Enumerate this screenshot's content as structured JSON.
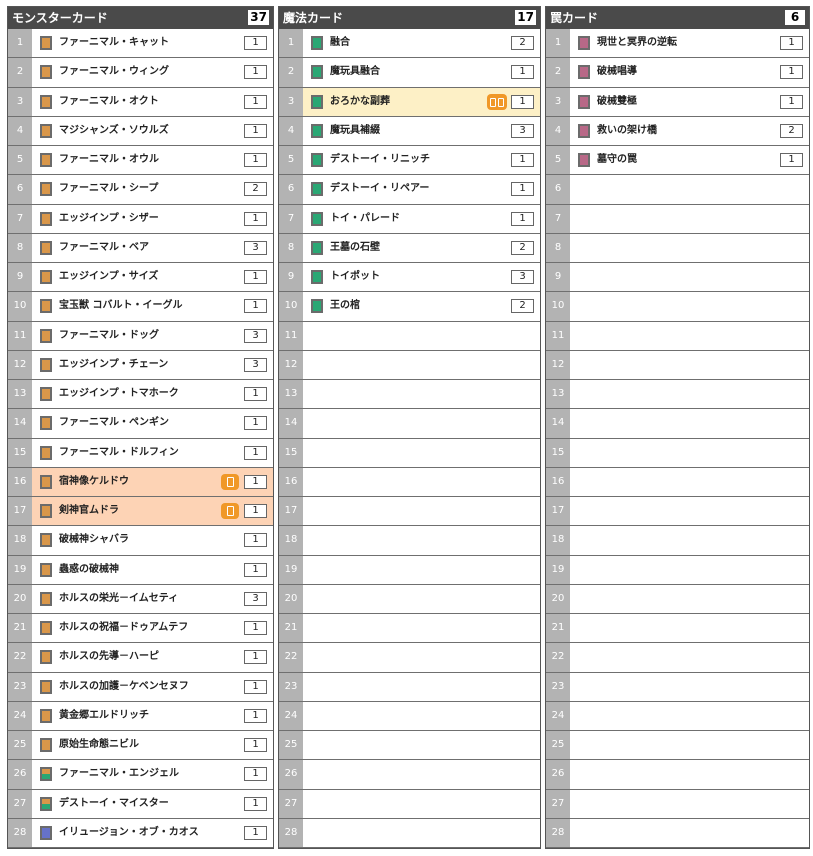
{
  "monster": {
    "title": "モンスターカード",
    "count": "37",
    "rows": [
      {
        "num": "1",
        "name": "ファーニマル・キャット",
        "qty": "1",
        "icon": "monster"
      },
      {
        "num": "2",
        "name": "ファーニマル・ウィング",
        "qty": "1",
        "icon": "monster"
      },
      {
        "num": "3",
        "name": "ファーニマル・オクト",
        "qty": "1",
        "icon": "monster"
      },
      {
        "num": "4",
        "name": "マジシャンズ・ソウルズ",
        "qty": "1",
        "icon": "monster"
      },
      {
        "num": "5",
        "name": "ファーニマル・オウル",
        "qty": "1",
        "icon": "monster"
      },
      {
        "num": "6",
        "name": "ファーニマル・シープ",
        "qty": "2",
        "icon": "monster"
      },
      {
        "num": "7",
        "name": "エッジインプ・シザー",
        "qty": "1",
        "icon": "monster"
      },
      {
        "num": "8",
        "name": "ファーニマル・ベア",
        "qty": "3",
        "icon": "monster"
      },
      {
        "num": "9",
        "name": "エッジインプ・サイズ",
        "qty": "1",
        "icon": "monster"
      },
      {
        "num": "10",
        "name": "宝玉獣 コバルト・イーグル",
        "qty": "1",
        "icon": "monster"
      },
      {
        "num": "11",
        "name": "ファーニマル・ドッグ",
        "qty": "3",
        "icon": "monster"
      },
      {
        "num": "12",
        "name": "エッジインプ・チェーン",
        "qty": "3",
        "icon": "monster"
      },
      {
        "num": "13",
        "name": "エッジインプ・トマホーク",
        "qty": "1",
        "icon": "monster"
      },
      {
        "num": "14",
        "name": "ファーニマル・ペンギン",
        "qty": "1",
        "icon": "monster"
      },
      {
        "num": "15",
        "name": "ファーニマル・ドルフィン",
        "qty": "1",
        "icon": "monster"
      },
      {
        "num": "16",
        "name": "宿神像ケルドウ",
        "qty": "1",
        "icon": "monster",
        "hl": "orange",
        "badge": "single"
      },
      {
        "num": "17",
        "name": "剣神官ムドラ",
        "qty": "1",
        "icon": "monster",
        "hl": "orange",
        "badge": "single"
      },
      {
        "num": "18",
        "name": "破械神シャバラ",
        "qty": "1",
        "icon": "monster"
      },
      {
        "num": "19",
        "name": "蟲惑の破械神",
        "qty": "1",
        "icon": "monster"
      },
      {
        "num": "20",
        "name": "ホルスの栄光－イムセティ",
        "qty": "3",
        "icon": "monster"
      },
      {
        "num": "21",
        "name": "ホルスの祝福－ドゥアムテフ",
        "qty": "1",
        "icon": "monster"
      },
      {
        "num": "22",
        "name": "ホルスの先導－ハーピ",
        "qty": "1",
        "icon": "monster"
      },
      {
        "num": "23",
        "name": "ホルスの加護－ケベンセヌフ",
        "qty": "1",
        "icon": "monster"
      },
      {
        "num": "24",
        "name": "黄金郷エルドリッチ",
        "qty": "1",
        "icon": "monster"
      },
      {
        "num": "25",
        "name": "原始生命態ニビル",
        "qty": "1",
        "icon": "monster"
      },
      {
        "num": "26",
        "name": "ファーニマル・エンジェル",
        "qty": "1",
        "icon": "teal"
      },
      {
        "num": "27",
        "name": "デストーイ・マイスター",
        "qty": "1",
        "icon": "teal"
      },
      {
        "num": "28",
        "name": "イリュージョン・オブ・カオス",
        "qty": "1",
        "icon": "purple"
      }
    ]
  },
  "spell": {
    "title": "魔法カード",
    "count": "17",
    "rows": [
      {
        "num": "1",
        "name": "融合",
        "qty": "2",
        "icon": "spell"
      },
      {
        "num": "2",
        "name": "魔玩具融合",
        "qty": "1",
        "icon": "spell"
      },
      {
        "num": "3",
        "name": "おろかな副葬",
        "qty": "1",
        "icon": "spell",
        "hl": "yellow",
        "badge": "double"
      },
      {
        "num": "4",
        "name": "魔玩具補綴",
        "qty": "3",
        "icon": "spell"
      },
      {
        "num": "5",
        "name": "デストーイ・リニッチ",
        "qty": "1",
        "icon": "spell"
      },
      {
        "num": "6",
        "name": "デストーイ・リペアー",
        "qty": "1",
        "icon": "spell"
      },
      {
        "num": "7",
        "name": "トイ・パレード",
        "qty": "1",
        "icon": "spell"
      },
      {
        "num": "8",
        "name": "王墓の石壁",
        "qty": "2",
        "icon": "spell"
      },
      {
        "num": "9",
        "name": "トイポット",
        "qty": "3",
        "icon": "spell"
      },
      {
        "num": "10",
        "name": "王の棺",
        "qty": "2",
        "icon": "spell"
      },
      {
        "num": "11"
      },
      {
        "num": "12"
      },
      {
        "num": "13"
      },
      {
        "num": "14"
      },
      {
        "num": "15"
      },
      {
        "num": "16"
      },
      {
        "num": "17"
      },
      {
        "num": "18"
      },
      {
        "num": "19"
      },
      {
        "num": "20"
      },
      {
        "num": "21"
      },
      {
        "num": "22"
      },
      {
        "num": "23"
      },
      {
        "num": "24"
      },
      {
        "num": "25"
      },
      {
        "num": "26"
      },
      {
        "num": "27"
      },
      {
        "num": "28"
      }
    ]
  },
  "trap": {
    "title": "罠カード",
    "count": "6",
    "rows": [
      {
        "num": "1",
        "name": "現世と冥界の逆転",
        "qty": "1",
        "icon": "trap"
      },
      {
        "num": "2",
        "name": "破械唱導",
        "qty": "1",
        "icon": "trap"
      },
      {
        "num": "3",
        "name": "破械雙極",
        "qty": "1",
        "icon": "trap"
      },
      {
        "num": "4",
        "name": "救いの架け橋",
        "qty": "2",
        "icon": "trap"
      },
      {
        "num": "5",
        "name": "墓守の罠",
        "qty": "1",
        "icon": "trap"
      },
      {
        "num": "6"
      },
      {
        "num": "7"
      },
      {
        "num": "8"
      },
      {
        "num": "9"
      },
      {
        "num": "10"
      },
      {
        "num": "11"
      },
      {
        "num": "12"
      },
      {
        "num": "13"
      },
      {
        "num": "14"
      },
      {
        "num": "15"
      },
      {
        "num": "16"
      },
      {
        "num": "17"
      },
      {
        "num": "18"
      },
      {
        "num": "19"
      },
      {
        "num": "20"
      },
      {
        "num": "21"
      },
      {
        "num": "22"
      },
      {
        "num": "23"
      },
      {
        "num": "24"
      },
      {
        "num": "25"
      },
      {
        "num": "26"
      },
      {
        "num": "27"
      },
      {
        "num": "28"
      }
    ]
  },
  "colors": {
    "header_bg": "#4a4a4a",
    "number_bg": "#b3b3b3",
    "highlight_orange": "#fdd3b5",
    "highlight_yellow": "#fdf0c6",
    "badge": "#f09828",
    "monster_icon": "#d9974a",
    "spell_icon": "#2aa774",
    "trap_icon": "#b86887",
    "purple_icon": "#6672c8"
  }
}
